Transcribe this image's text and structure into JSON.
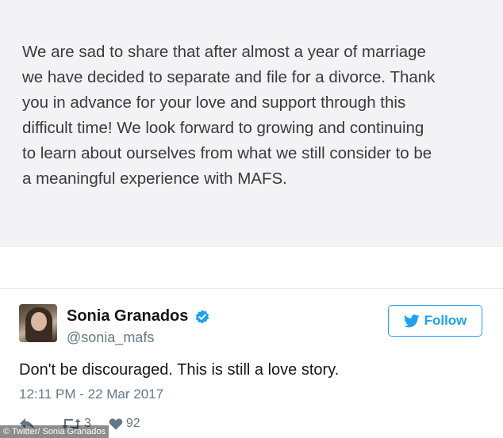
{
  "statement": {
    "text": "We are sad to share that after almost a year of marriage\nwe have decided to separate and file for a divorce. Thank\nyou in advance for your love and support through this\ndifficult time! We look forward to growing and continuing\nto learn about ourselves from what we still consider to be\na meaningful experience with MAFS."
  },
  "tweet": {
    "display_name": "Sonia Granados",
    "handle": "@sonia_mafs",
    "follow_label": "Follow",
    "text": "Don't be discouraged. This is still a love story.",
    "timestamp": "12:11 PM - 22 Mar 2017",
    "retweet_count": "3",
    "like_count": "92"
  },
  "credit": "© Twitter/ Sonia Granados",
  "colors": {
    "twitter_blue": "#1da1f2",
    "statement_bg": "#f3f2f4",
    "muted_text": "#657786"
  },
  "icons": {
    "verified": "verified-badge-icon",
    "follow": "twitter-bird-icon",
    "reply": "reply-icon",
    "retweet": "retweet-icon",
    "like": "heart-icon"
  }
}
